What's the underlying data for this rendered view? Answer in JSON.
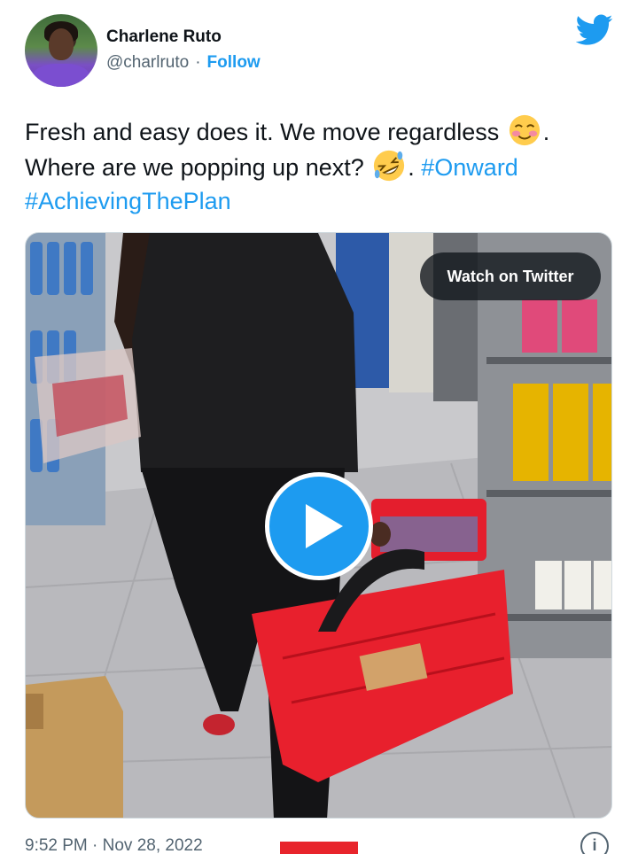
{
  "user": {
    "name": "Charlene Ruto",
    "handle": "@charlruto",
    "separator": "·",
    "follow_label": "Follow"
  },
  "tweet": {
    "line1_text": "Fresh and easy does it. We move regardless ",
    "line1_end": ".",
    "line2_text": "Where are we popping up next? ",
    "line2_after_emoji": ". ",
    "hashtag1": "#Onward",
    "hashtag2": "#AchievingThePlan"
  },
  "video": {
    "watch_label": "Watch on Twitter"
  },
  "footer": {
    "timestamp": "9:52 PM · Nov 28, 2022",
    "info_glyph": "i"
  },
  "colors": {
    "accent": "#1d9bf0",
    "text": "#0f1419",
    "muted": "#536471",
    "red_bar": "#e8242b"
  },
  "icons": [
    "twitter-bird-icon",
    "smiling-blush-emoji",
    "rolling-laughing-emoji",
    "play-icon",
    "info-icon"
  ]
}
